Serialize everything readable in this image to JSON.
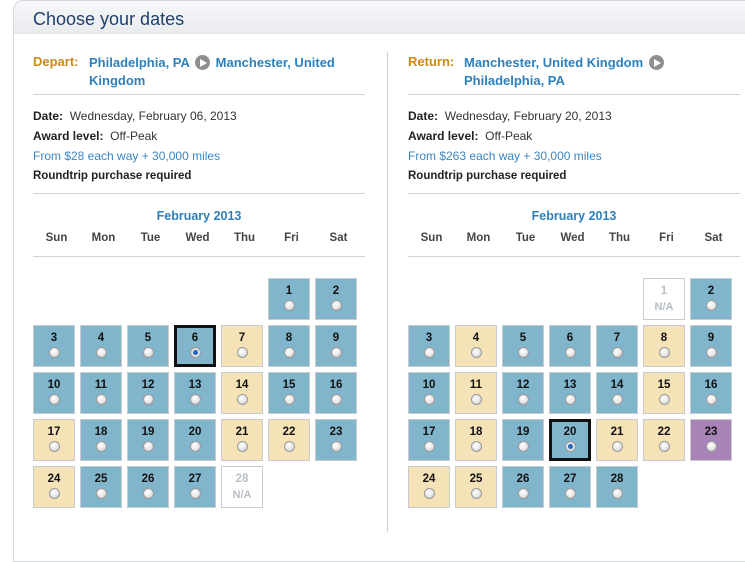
{
  "header": {
    "title": "Choose your dates"
  },
  "depart": {
    "label": "Depart:",
    "origin": "Philadelphia, PA",
    "destination": "Manchester, United Kingdom",
    "date_label": "Date:",
    "date_value": "Wednesday, February 06, 2013",
    "award_label": "Award level:",
    "award_value": "Off-Peak",
    "price": "From $28 each way + 30,000 miles",
    "requirement": "Roundtrip purchase required",
    "calendar": {
      "month": "February 2013",
      "weekdays": [
        "Sun",
        "Mon",
        "Tue",
        "Wed",
        "Thu",
        "Fri",
        "Sat"
      ],
      "first_weekday_index": 5,
      "selected_day": 6,
      "days": [
        {
          "day": "1",
          "status": "blue"
        },
        {
          "day": "2",
          "status": "blue"
        },
        {
          "day": "3",
          "status": "blue"
        },
        {
          "day": "4",
          "status": "blue"
        },
        {
          "day": "5",
          "status": "blue"
        },
        {
          "day": "6",
          "status": "blue"
        },
        {
          "day": "7",
          "status": "tan"
        },
        {
          "day": "8",
          "status": "blue"
        },
        {
          "day": "9",
          "status": "blue"
        },
        {
          "day": "10",
          "status": "blue"
        },
        {
          "day": "11",
          "status": "blue"
        },
        {
          "day": "12",
          "status": "blue"
        },
        {
          "day": "13",
          "status": "blue"
        },
        {
          "day": "14",
          "status": "tan"
        },
        {
          "day": "15",
          "status": "blue"
        },
        {
          "day": "16",
          "status": "blue"
        },
        {
          "day": "17",
          "status": "tan"
        },
        {
          "day": "18",
          "status": "blue"
        },
        {
          "day": "19",
          "status": "blue"
        },
        {
          "day": "20",
          "status": "blue"
        },
        {
          "day": "21",
          "status": "tan"
        },
        {
          "day": "22",
          "status": "tan"
        },
        {
          "day": "23",
          "status": "blue"
        },
        {
          "day": "24",
          "status": "tan"
        },
        {
          "day": "25",
          "status": "blue"
        },
        {
          "day": "26",
          "status": "blue"
        },
        {
          "day": "27",
          "status": "blue"
        },
        {
          "day": "28",
          "status": "na"
        }
      ]
    }
  },
  "return": {
    "label": "Return:",
    "origin": "Manchester, United Kingdom",
    "destination": "Philadelphia, PA",
    "date_label": "Date:",
    "date_value": "Wednesday, February 20, 2013",
    "award_label": "Award level:",
    "award_value": "Off-Peak",
    "price": "From $263 each way + 30,000 miles",
    "requirement": "Roundtrip purchase required",
    "calendar": {
      "month": "February 2013",
      "weekdays": [
        "Sun",
        "Mon",
        "Tue",
        "Wed",
        "Thu",
        "Fri",
        "Sat"
      ],
      "first_weekday_index": 5,
      "selected_day": 20,
      "days": [
        {
          "day": "1",
          "status": "na"
        },
        {
          "day": "2",
          "status": "blue"
        },
        {
          "day": "3",
          "status": "blue"
        },
        {
          "day": "4",
          "status": "tan"
        },
        {
          "day": "5",
          "status": "blue"
        },
        {
          "day": "6",
          "status": "blue"
        },
        {
          "day": "7",
          "status": "blue"
        },
        {
          "day": "8",
          "status": "tan"
        },
        {
          "day": "9",
          "status": "blue"
        },
        {
          "day": "10",
          "status": "blue"
        },
        {
          "day": "11",
          "status": "tan"
        },
        {
          "day": "12",
          "status": "blue"
        },
        {
          "day": "13",
          "status": "blue"
        },
        {
          "day": "14",
          "status": "blue"
        },
        {
          "day": "15",
          "status": "tan"
        },
        {
          "day": "16",
          "status": "blue"
        },
        {
          "day": "17",
          "status": "blue"
        },
        {
          "day": "18",
          "status": "tan"
        },
        {
          "day": "19",
          "status": "blue"
        },
        {
          "day": "20",
          "status": "blue"
        },
        {
          "day": "21",
          "status": "tan"
        },
        {
          "day": "22",
          "status": "tan"
        },
        {
          "day": "23",
          "status": "purple"
        },
        {
          "day": "24",
          "status": "tan"
        },
        {
          "day": "25",
          "status": "tan"
        },
        {
          "day": "26",
          "status": "blue"
        },
        {
          "day": "27",
          "status": "blue"
        },
        {
          "day": "28",
          "status": "blue"
        }
      ]
    }
  },
  "na_text": "N/A",
  "icons": {
    "route_arrow": "arrow-right-circle-icon",
    "day_radio": "radio-button"
  },
  "colors": {
    "available": "#81b5cb",
    "limited": "#f5e2b7",
    "special": "#a783b7",
    "unavailable": "#ffffff",
    "label_orange": "#cc8a16",
    "link_blue": "#2e80bd",
    "title_navy": "#1d3f6d"
  }
}
